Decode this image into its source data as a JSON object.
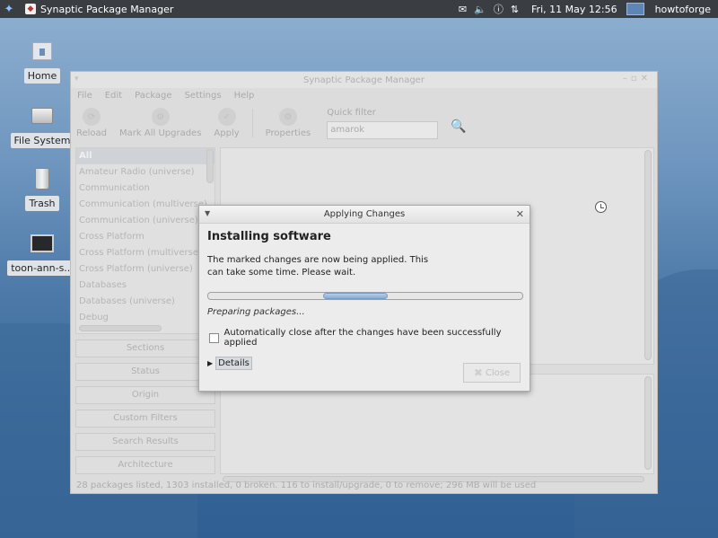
{
  "panel": {
    "app_title": "Synaptic Package Manager",
    "clock": "Fri, 11 May  12:56",
    "user": "howtoforge"
  },
  "desktop": {
    "icons": [
      {
        "label": "Home",
        "icon": "home-folder-icon"
      },
      {
        "label": "File System",
        "icon": "drive-icon"
      },
      {
        "label": "Trash",
        "icon": "trash-icon"
      },
      {
        "label": "toon-ann-s...",
        "icon": "screenshot-file-icon"
      }
    ]
  },
  "main_window": {
    "title": "Synaptic Package Manager",
    "menu": [
      "File",
      "Edit",
      "Package",
      "Settings",
      "Help"
    ],
    "toolbar": {
      "reload": "Reload",
      "mark_all_upgrades": "Mark All Upgrades",
      "apply": "Apply",
      "properties": "Properties",
      "quick_filter_label": "Quick filter",
      "quick_filter_value": "amarok"
    },
    "categories": [
      "All",
      "Amateur Radio (universe)",
      "Communication",
      "Communication (multiverse)",
      "Communication (universe)",
      "Cross Platform",
      "Cross Platform (multiverse)",
      "Cross Platform (universe)",
      "Databases",
      "Databases (universe)",
      "Debug"
    ],
    "sidebar_buttons": [
      "Sections",
      "Status",
      "Origin",
      "Custom Filters",
      "Search Results",
      "Architecture"
    ],
    "status": "28 packages listed, 1303 installed, 0 broken. 116 to install/upgrade, 0 to remove; 296 MB will be used"
  },
  "dialog": {
    "title": "Applying Changes",
    "heading": "Installing software",
    "message": "The marked changes are now being applied. This can take some time. Please wait.",
    "progress_text": "Preparing packages...",
    "auto_close_label": "Automatically close after the changes have been successfully applied",
    "auto_close_checked": false,
    "details_label": "Details",
    "close_label": "Close"
  },
  "colors": {
    "panel_bg": "#3a3d42",
    "desktop_bg": "#4c79a8",
    "progress_pulse": "#8cadd4"
  }
}
